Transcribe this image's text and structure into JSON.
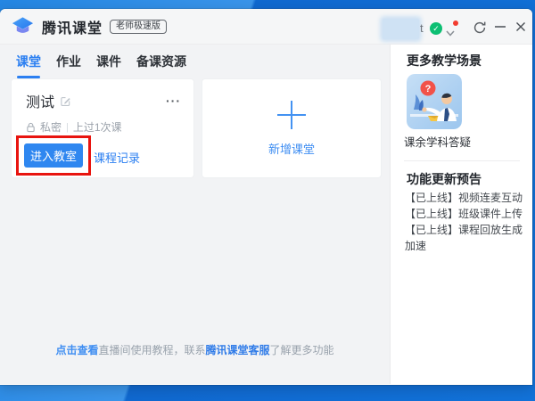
{
  "colors": {
    "accent_blue": "#2b7ff1",
    "button_blue": "#2f87f0",
    "link_blue": "#3f8ef2",
    "annotation_red": "#e8140f",
    "account_green": "#0dbf73",
    "notification_red": "#f23c30",
    "desktop_blue": "#1272d8"
  },
  "titlebar": {
    "app_title": "腾讯课堂",
    "edition_badge": "老师极速版",
    "redacted_fragment": "t",
    "account_check": "✓"
  },
  "tabs": [
    {
      "label": "课堂",
      "active": true
    },
    {
      "label": "作业",
      "active": false
    },
    {
      "label": "课件",
      "active": false
    },
    {
      "label": "备课资源",
      "active": false
    }
  ],
  "course_card": {
    "title": "测试",
    "privacy": "私密",
    "separator": "|",
    "lessons": "上过1次课",
    "more": "···",
    "enter_button": "进入教室",
    "records_link": "课程记录"
  },
  "new_card": {
    "label": "新增课堂"
  },
  "sidebar": {
    "scenes_title": "更多教学场景",
    "scene_badge": "?",
    "scene_caption": "课余学科答疑",
    "updates_title": "功能更新预告",
    "updates": [
      "【已上线】视频连麦互动",
      "【已上线】班级课件上传",
      "【已上线】课程回放生成加速"
    ]
  },
  "footer": {
    "link_view": "点击查看",
    "text_mid": "直播间使用教程，联系",
    "link_support": "腾讯课堂客服",
    "text_end": "了解更多功能"
  }
}
